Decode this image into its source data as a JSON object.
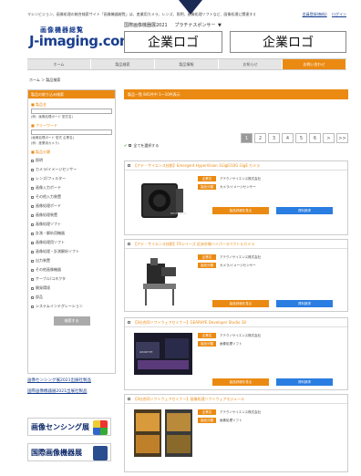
{
  "header": {
    "tagline": "マシンビジョン、画像処理の総合検索サイト「画像機器総覧」は、産業用カメラ、レンズ、照明、画像処理ソフトなど、画像処理に関連する製品情報を紹介しております。",
    "links": [
      "会員登録(無料)",
      "ログイン"
    ],
    "logo_sub": "画像機器総覧",
    "logo_main": "J-imaging.com",
    "exhibition": "国際画像機器展2021",
    "sponsor": "プラチナスポンサー",
    "sponsor_mark": "▼",
    "corp_logo_1": "企業ロゴ",
    "corp_logo_2": "企業ロゴ"
  },
  "nav": [
    "ホーム",
    "製品検索",
    "製品情報",
    "お知らせ",
    "お問い合わせ"
  ],
  "breadcrumb": "ホーム ＞ 製品検索",
  "sidebar": {
    "title": "製品の絞り込み検索",
    "keyword_label": "■ 製品名",
    "keyword_hint": "(例：画像処理ボード 型式名)",
    "freeword_label": "■ フリーワード",
    "freeword_hint": "(画像処理ボード 型式 企業名)",
    "freeword_hint2": "(例：産業用カメラ)",
    "category_label": "■ 製品分類",
    "categories": [
      "照明",
      "カメラ/イメージセンサー",
      "レンズ/フィルター",
      "画像入力ボード",
      "その他入力装置",
      "画像処理ボード",
      "画像処理装置",
      "画像処理ソフト",
      "計測・解析用機器",
      "画像処理用ソフト",
      "画像処理・計測解析ソフト",
      "出力装置",
      "その他画像機器",
      "ケーブル/コネクタ",
      "開発環境",
      "部品",
      "システムインテグレーション"
    ],
    "search_button": "検索する",
    "ext_link_1": "画像センシング展2021出展社製品",
    "ext_link_2": "国際画像機器展2021出展社製品",
    "banner_1": "画像センシング展",
    "banner_2": "国際画像機器展"
  },
  "main": {
    "header": "製品一覧 841件中 1～10件表示",
    "select_all": "全てを選択する",
    "pages": [
      "1",
      "2",
      "3",
      "4",
      "5",
      "6",
      ">",
      ">>"
    ],
    "products": [
      {
        "title": "【アテ・サイエンス技術】Emergent HyperVision 1GigE/10G GigE カメラ",
        "company_tag": "企業名",
        "company": "アテクノサイエンス株式会社",
        "category_tag": "製品分類",
        "category": "カメラ/イメージセンサー",
        "btn1": "製品詳細を見る",
        "btn2": "資料請求"
      },
      {
        "title": "【アテ・サイエンス技術】FXシリーズ 近赤外線ハイパースペクトルカメラ",
        "company_tag": "企業名",
        "company": "アテクノサイエンス株式会社",
        "category_tag": "製品分類",
        "category": "カメラ/イメージセンサー",
        "btn1": "製品詳細を見る",
        "btn2": "資料請求"
      },
      {
        "title": "【3社合同ソフトウェアセミナー】GEARHYE Developer Studio 18",
        "company_tag": "企業名",
        "company": "アテクノサイエンス株式会社",
        "category_tag": "製品分類",
        "category": "画像処理ソフト",
        "btn1": "製品詳細を見る",
        "btn2": "資料請求"
      },
      {
        "title": "【3社合同ソフトウェアセミナー】画像処理ソフトウェアモジュール",
        "company_tag": "企業名",
        "company": "アテクノサイエンス株式会社",
        "category_tag": "製品分類",
        "category": "画像処理ソフト",
        "btn1": "製品詳細を見る",
        "btn2": "資料請求"
      }
    ]
  }
}
